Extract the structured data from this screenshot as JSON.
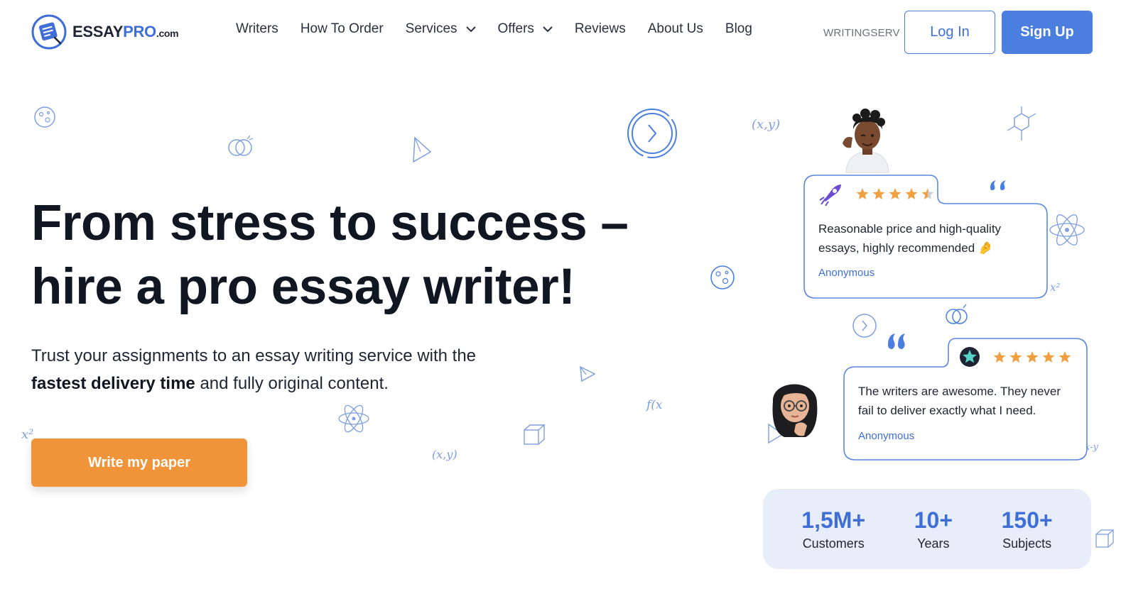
{
  "header": {
    "logo": {
      "essay": "ESSAY",
      "pro": "PRO",
      "com": ".com"
    },
    "nav": [
      {
        "label": "Writers",
        "has_dropdown": false
      },
      {
        "label": "How To Order",
        "has_dropdown": false
      },
      {
        "label": "Services",
        "has_dropdown": true
      },
      {
        "label": "Offers",
        "has_dropdown": true
      },
      {
        "label": "Reviews",
        "has_dropdown": false
      },
      {
        "label": "About Us",
        "has_dropdown": false
      },
      {
        "label": "Blog",
        "has_dropdown": false
      }
    ],
    "promo_code": "WRITINGSERV",
    "login_label": "Log In",
    "signup_label": "Sign Up"
  },
  "hero": {
    "title_line1": "From stress to success –",
    "title_line2": "hire a pro essay writer!",
    "subtitle_part1": "Trust your assignments to an essay writing service with the",
    "subtitle_bold": "fastest delivery time",
    "subtitle_part2": "and fully original content.",
    "cta_label": "Write my paper"
  },
  "reviews": [
    {
      "text": "Reasonable price and high-quality essays, highly recommended 🤌",
      "author": "Anonymous",
      "rating": 4.5,
      "icon": "rocket-icon"
    },
    {
      "text": "The writers are awesome. They never fail to deliver exactly what I need.",
      "author": "Anonymous",
      "rating": 5,
      "icon": "star-badge-icon"
    }
  ],
  "stats": [
    {
      "value": "1,5M+",
      "label": "Customers"
    },
    {
      "value": "10+",
      "label": "Years"
    },
    {
      "value": "150+",
      "label": "Subjects"
    }
  ],
  "colors": {
    "accent_blue": "#4a7fe0",
    "cta_orange": "#f0943a",
    "star_orange": "#f0a040",
    "stats_bg": "#e8eef9"
  }
}
